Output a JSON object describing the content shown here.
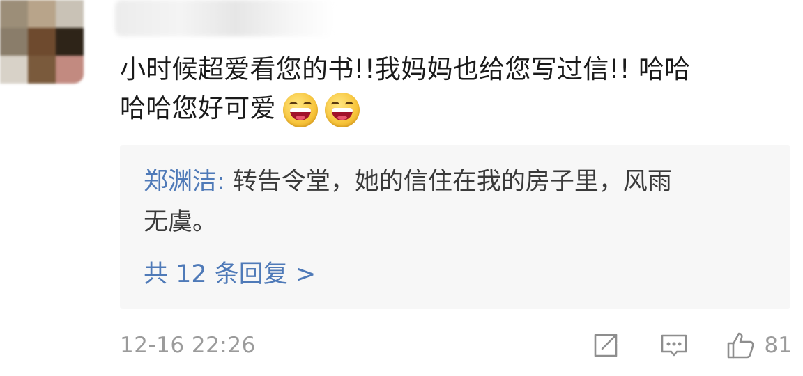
{
  "comment": {
    "line1": "小时候超爱看您的书!!我妈妈也给您写过信!! 哈哈",
    "line2": "哈哈您好可爱",
    "emojis": [
      "laughing-emoji",
      "laughing-emoji"
    ]
  },
  "reply": {
    "author": "郑渊洁:",
    "text_line1": " 转告令堂，她的信住在我的房子里，风雨",
    "text_line2": "无虞。",
    "more_label": "共 12 条回复 >"
  },
  "meta": {
    "timestamp": "12-16 22:26",
    "like_count": "81"
  },
  "icons": {
    "share": "share-icon",
    "comment": "comment-icon",
    "like": "thumbs-up-icon"
  },
  "colors": {
    "link_blue": "#4f7ab8",
    "text_main": "#1a1a1a",
    "meta_gray": "#9b9b9b",
    "reply_bg": "#f7f7f7"
  }
}
